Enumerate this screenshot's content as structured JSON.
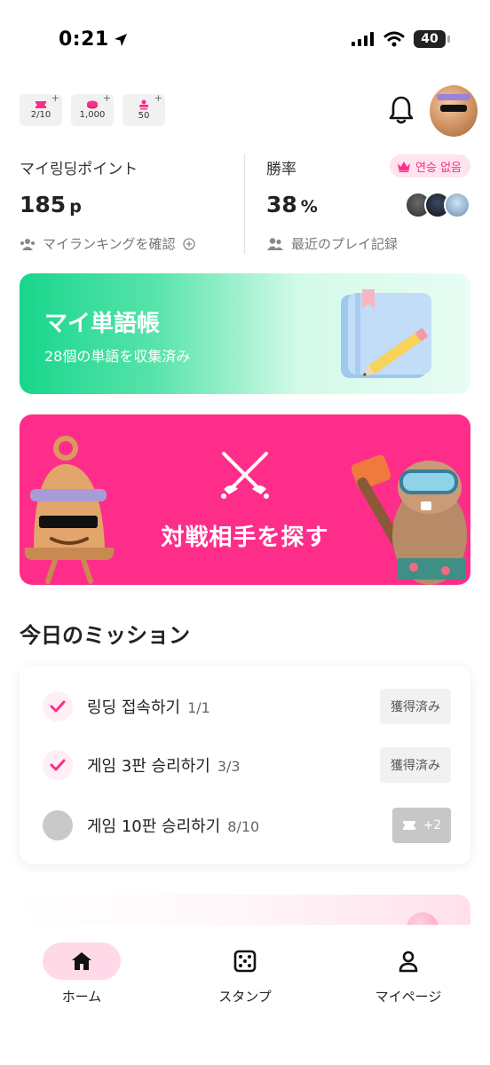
{
  "status_bar": {
    "time": "0:21",
    "battery": "40"
  },
  "header": {
    "chips": [
      {
        "icon": "ticket-icon",
        "value": "2/10"
      },
      {
        "icon": "coin-icon",
        "value": "1,000"
      },
      {
        "icon": "stamp-icon",
        "value": "50"
      }
    ],
    "chip_plus": "+"
  },
  "stats": {
    "points_title": "マイ링딩ポイント",
    "points_value": "185",
    "points_unit": "p",
    "ranking_link": "マイランキングを確認",
    "winrate_title": "勝率",
    "winrate_value": "38",
    "winrate_unit": "%",
    "streak_badge": "연승 없음",
    "history_link": "最近のプレイ記録"
  },
  "vocab_card": {
    "title": "マイ単語帳",
    "subtitle": "28個の単語を収集済み"
  },
  "match_card": {
    "title": "対戦相手を探す"
  },
  "missions": {
    "heading": "今日のミッション",
    "items": [
      {
        "label": "링딩 접속하기",
        "progress": "1/1",
        "status": "獲得済み"
      },
      {
        "label": "게임 3판 승리하기",
        "progress": "3/3",
        "status": "獲得済み"
      },
      {
        "label": "게임 10판 승리하기",
        "progress": "8/10",
        "reward": "+2"
      }
    ]
  },
  "bottom_nav": [
    {
      "label": "ホーム",
      "icon": "home-icon",
      "active": true
    },
    {
      "label": "スタンプ",
      "icon": "dice-icon",
      "active": false
    },
    {
      "label": "マイページ",
      "icon": "person-icon",
      "active": false
    }
  ],
  "colors": {
    "accent": "#ff2d8a",
    "green": "#18d68c"
  }
}
